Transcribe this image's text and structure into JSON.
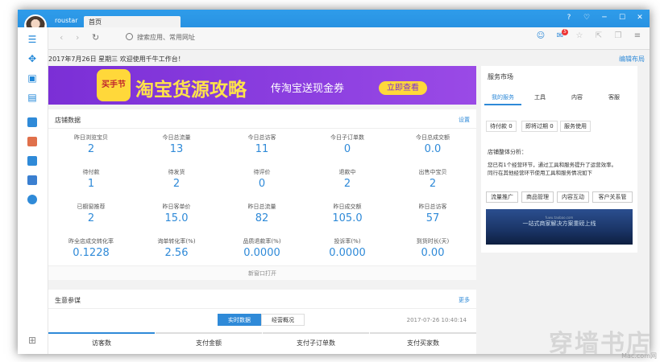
{
  "titlebar": {
    "username": "roustar",
    "tab_label": "首页",
    "controls": [
      "?",
      "♡",
      "─",
      "☐",
      "✕"
    ]
  },
  "addressbar": {
    "placeholder": "搜索应用、常用网址",
    "mail_badge": "5"
  },
  "datebar": {
    "date_text": "2017年7月26日 星期三 欢迎使用千牛工作台！",
    "edit_layout": "编辑布局"
  },
  "banner": {
    "logo_text": "买手节",
    "title": "淘宝货源攻略",
    "subtitle": "传淘宝送现金券",
    "button": "立即查看"
  },
  "store": {
    "title": "店铺数据",
    "settings": "设置",
    "rows": [
      [
        {
          "label": "昨日浏览宝贝",
          "value": "2"
        },
        {
          "label": "今日总流量",
          "value": "13"
        },
        {
          "label": "今日总访客",
          "value": "11"
        },
        {
          "label": "今日子订单数",
          "value": "0"
        },
        {
          "label": "今日总成交额",
          "value": "0.0"
        }
      ],
      [
        {
          "label": "待付款",
          "value": "1"
        },
        {
          "label": "待发货",
          "value": "2"
        },
        {
          "label": "待评价",
          "value": "0"
        },
        {
          "label": "退款中",
          "value": "2"
        },
        {
          "label": "出售中宝贝",
          "value": "2"
        }
      ],
      [
        {
          "label": "已橱窗推荐",
          "value": "2"
        },
        {
          "label": "昨日客单价",
          "value": "15.0"
        },
        {
          "label": "昨日总流量",
          "value": "82"
        },
        {
          "label": "昨日成交额",
          "value": "105.0"
        },
        {
          "label": "昨日总访客",
          "value": "57"
        }
      ],
      [
        {
          "label": "昨全店成交转化率",
          "value": "0.1228"
        },
        {
          "label": "询单转化率(%)",
          "value": "2.56"
        },
        {
          "label": "品质退款率(%)",
          "value": "0.0000"
        },
        {
          "label": "投诉率(%)",
          "value": "0.0000"
        },
        {
          "label": "到货时长(天)",
          "value": "0.00"
        }
      ]
    ],
    "open_new": "新窗口打开"
  },
  "business": {
    "title": "生意参谋",
    "more": "更多",
    "tabs": [
      "实时数据",
      "经营概况"
    ],
    "time": "2017-07-26 10:40:14",
    "columns": [
      "访客数",
      "支付金额",
      "支付子订单数",
      "支付买家数"
    ]
  },
  "service": {
    "title": "服务市场",
    "tabs": [
      "我的服务",
      "工具",
      "内容",
      "客服"
    ],
    "chips": [
      "待付款 0",
      "即将过期 0",
      "服务使用"
    ],
    "analysis_title": "店铺整体分析：",
    "analysis_text1": "您已有1个经营环节，通过工具和服务提升了运营效率。",
    "analysis_text2": "同行在其他经营环节使用工具和服务情况如下",
    "buttons": [
      "流量推广",
      "商品管理",
      "内容互动",
      "客户关系管"
    ],
    "ad_url": "fuwu.taobao.com",
    "ad_text": "一站式商家解决方案重磅上线"
  },
  "watermark": {
    "main": "穿墙书店",
    "sub": "Mac.com网"
  }
}
